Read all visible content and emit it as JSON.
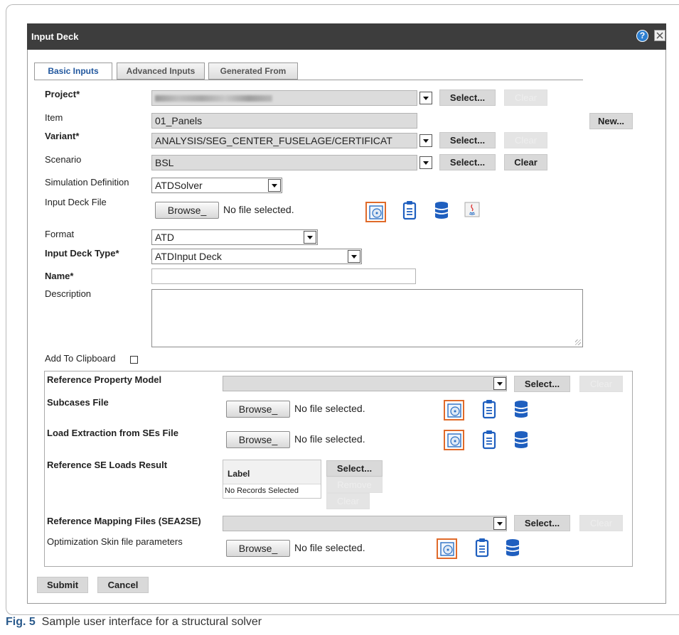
{
  "window": {
    "title": "Input Deck",
    "help_icon": "?",
    "close_icon": "close-icon"
  },
  "tabs": [
    "Basic Inputs",
    "Advanced Inputs",
    "Generated From"
  ],
  "form": {
    "project": {
      "label": "Project*",
      "value": "",
      "select": "Select...",
      "clear": "Clear"
    },
    "item": {
      "label": "Item",
      "value": "01_Panels",
      "new": "New..."
    },
    "variant": {
      "label": "Variant*",
      "value": "ANALYSIS/SEG_CENTER_FUSELAGE/CERTIFICAT",
      "select": "Select...",
      "clear": "Clear"
    },
    "scenario": {
      "label": "Scenario",
      "value": "BSL",
      "select": "Select...",
      "clear": "Clear"
    },
    "simulation_definition": {
      "label": "Simulation Definition",
      "value": "ATDSolver"
    },
    "input_deck_file": {
      "label": "Input Deck File",
      "browse": "Browse_",
      "status": "No file selected."
    },
    "format": {
      "label": "Format",
      "value": "ATD"
    },
    "input_deck_type": {
      "label": "Input Deck Type*",
      "value": "ATDInput Deck"
    },
    "name": {
      "label": "Name*",
      "value": ""
    },
    "description": {
      "label": "Description",
      "value": ""
    },
    "add_to_clipboard": {
      "label": "Add To Clipboard",
      "checked": false
    }
  },
  "references": {
    "property_model": {
      "label": "Reference Property Model",
      "select": "Select...",
      "clear": "Clear"
    },
    "subcases_file": {
      "label": "Subcases File",
      "browse": "Browse_",
      "status": "No file selected."
    },
    "load_extraction": {
      "label": "Load Extraction from SEs File",
      "browse": "Browse_",
      "status": "No file selected."
    },
    "se_loads_result": {
      "label": "Reference SE Loads Result",
      "grid_header": "Label",
      "grid_empty": "No Records Selected",
      "select": "Select...",
      "remove": "Remove",
      "clear": "Clear"
    },
    "mapping_files": {
      "label": "Reference Mapping Files (SEA2SE)",
      "select": "Select...",
      "clear": "Clear"
    },
    "optimization_skin": {
      "label": "Optimization Skin file parameters",
      "browse": "Browse_",
      "status": "No file selected."
    }
  },
  "footer": {
    "submit": "Submit",
    "cancel": "Cancel"
  },
  "caption": {
    "fig": "Fig. 5",
    "text": "Sample user interface for a structural solver"
  },
  "colors": {
    "titlebar": "#3d3d3d",
    "accent_border": "#e06a2a",
    "icon_blue": "#1f5fbf",
    "tab_active_text": "#21579e"
  },
  "icons": [
    "help-icon",
    "close-icon",
    "disc-icon",
    "clipboard-icon",
    "database-icon",
    "java-icon"
  ]
}
